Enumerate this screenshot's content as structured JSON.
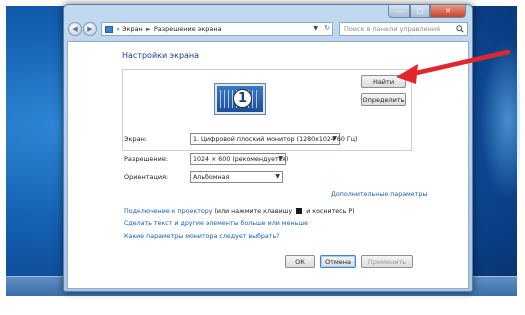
{
  "window": {
    "address": {
      "segments": [
        "Экран",
        "Разрешение экрана"
      ],
      "separator": "►",
      "chevron": "«"
    },
    "search_placeholder": "Поиск в панели управления",
    "controls": {
      "minimize": "—",
      "maximize": "□",
      "close": "✕"
    }
  },
  "content": {
    "heading": "Настройки экрана",
    "monitor_number": "1",
    "find_button": "Найти",
    "identify_button": "Определить",
    "display_label": "Экран:",
    "display_value": "1. Цифровой плоский монитор (1280x1024 60 Гц)",
    "resolution_label": "Разрешение:",
    "resolution_value": "1024 × 600 (рекомендуется)",
    "orientation_label": "Ориентация:",
    "orientation_value": "Альбомная",
    "advanced_link": "Дополнительные параметры",
    "projector_link": "Подключение к проектору",
    "projector_hint_before": "(или нажмите клавишу",
    "projector_hint_after": "и коснитесь P)",
    "text_size_link": "Сделать текст и другие элементы больше или меньше",
    "which_settings_link": "Какие параметры монитора следует выбрать?",
    "ok_button": "ОК",
    "cancel_button": "Отмена",
    "apply_button": "Применить"
  },
  "annotation": {
    "arrow_color": "#e2262b"
  }
}
